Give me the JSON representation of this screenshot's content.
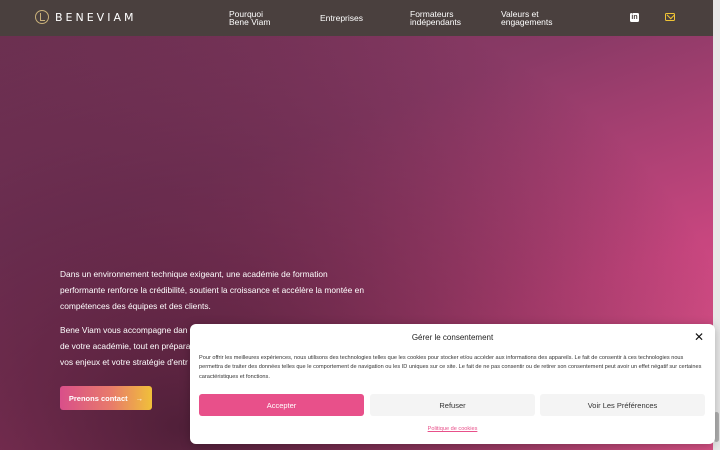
{
  "header": {
    "logo_text": "BENEVIAM",
    "nav": [
      {
        "line1": "Pourquoi",
        "line2": "Bene Viam"
      },
      {
        "line1": "Entreprises",
        "line2": ""
      },
      {
        "line1": "Formateurs",
        "line2": "indépendants"
      },
      {
        "line1": "Valeurs et",
        "line2": "engagements"
      }
    ],
    "icons": [
      "linkedin-icon",
      "mail-icon"
    ]
  },
  "hero": {
    "paragraph1": "Dans un environnement technique exigeant, une académie de formation performante renforce la crédibilité, soutient la croissance et accélère la montée en compétences des équipes et des clients.",
    "paragraph2_visible": "Bene Viam vous accompagne dan",
    "paragraph2_line2": "de votre académie, tout en prépara",
    "paragraph2_line3": "vos enjeux et votre stratégie d'entr",
    "cta_label": "Prenons contact",
    "cta_arrow": "→"
  },
  "consent": {
    "title": "Gérer le consentement",
    "close": "✕",
    "body": "Pour offrir les meilleures expériences, nous utilisons des technologies telles que les cookies pour stocker et/ou accéder aux informations des appareils. Le fait de consentir à ces technologies nous permettra de traiter des données telles que le comportement de navigation ou les ID uniques sur ce site. Le fait de ne pas consentir ou de retirer son consentement peut avoir un effet négatif sur certaines caractéristiques et fonctions.",
    "accept": "Accepter",
    "refuse": "Refuser",
    "preferences": "Voir Les Préférences",
    "policy_link": "Politique de cookies"
  },
  "colors": {
    "header_bg": "#4a403e",
    "accent_pink": "#e8508a",
    "accent_yellow": "#f0c435"
  }
}
